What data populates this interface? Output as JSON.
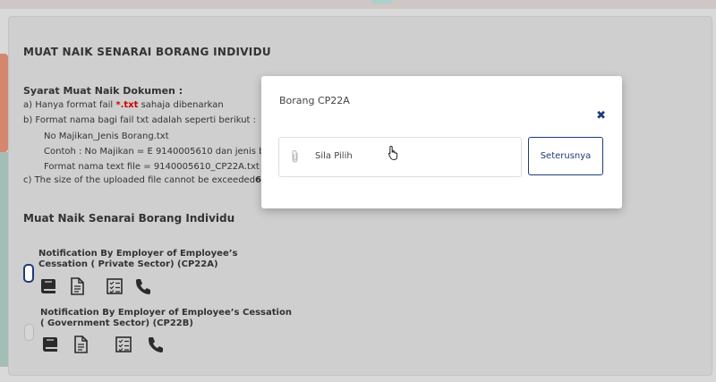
{
  "page": {
    "title": "MUAT NAIK SENARAI BORANG INDIVIDU"
  },
  "requirements": {
    "title": "Syarat Muat Naik Dokumen :",
    "line_a_prefix": "a) Hanya format fail ",
    "line_a_ext": "*.txt",
    "line_a_suffix": " sahaja dibenarkan",
    "line_b": "b) Format nama bagi fail txt adalah seperti berikut :",
    "line_b1": "No Majikan_Jenis Borang.txt",
    "line_b2": "Contoh : No Majikan = E 9140005610 dan jenis b",
    "line_b3": "Format nama text file = 9140005610_CP22A.txt",
    "line_c_prefix": "c) The size of the uploaded file cannot be exceeded",
    "line_c_bold": "6"
  },
  "section": {
    "title": "Muat Naik Senarai Borang Individu"
  },
  "forms": [
    {
      "label_line1": "Notification By Employer of Employee’s",
      "label_line2": "Cessation ( Private Sector) (CP22A)",
      "selected": true
    },
    {
      "label_line1": "Notification By Employer of Employee’s Cessation",
      "label_line2": "( Government Sector) (CP22B)",
      "selected": false
    }
  ],
  "icons": [
    "book-icon",
    "document-icon",
    "checklist-icon",
    "phone-icon"
  ],
  "modal": {
    "title": "Borang CP22A",
    "close_symbol": "✖",
    "file_placeholder": "Sila Pilih",
    "next_label": "Seterusnya"
  },
  "colors": {
    "accent": "#1f3b7a",
    "highlight_red": "#cc0000"
  }
}
